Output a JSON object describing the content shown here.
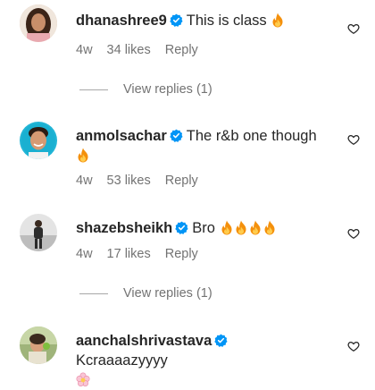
{
  "comments": [
    {
      "username": "dhanashree9",
      "text": "This is class",
      "time": "4w",
      "likes": "34 likes",
      "reply": "Reply",
      "avatar_icon": "avatar-woman-long-hair"
    },
    {
      "username": "anmolsachar",
      "text": "The r&b one though",
      "time": "4w",
      "likes": "53 likes",
      "reply": "Reply",
      "avatar_icon": "avatar-man-smiling"
    },
    {
      "username": "shazebsheikh",
      "text": "Bro",
      "time": "4w",
      "likes": "17 likes",
      "reply": "Reply",
      "avatar_icon": "avatar-man-standing"
    },
    {
      "username": "aanchalshrivastava",
      "text": "Kcraaaazyyyy",
      "avatar_icon": "avatar-woman-outdoor"
    }
  ],
  "view_replies": [
    {
      "label": "View replies (1)"
    },
    {
      "label": "View replies (1)"
    }
  ],
  "colors": {
    "text": "#262626",
    "secondary": "#737373",
    "verified_blue": "#0095f6",
    "fire_outer": "#f4900c",
    "fire_inner": "#ffcc4d"
  },
  "icons": {
    "verified": "verified-badge-icon",
    "fire": "fire-emoji",
    "flower": "blossom-emoji",
    "like": "heart-outline-icon"
  }
}
